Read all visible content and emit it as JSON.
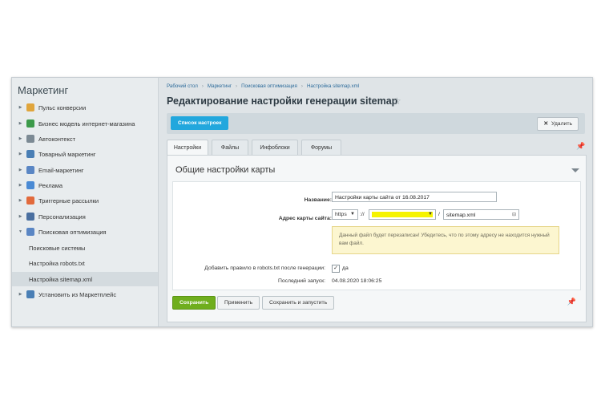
{
  "sidebar": {
    "title": "Маркетинг",
    "items": [
      {
        "label": "Пульс конверсии",
        "icon": "funnel-icon",
        "color": "#e0a53c"
      },
      {
        "label": "Бизнес модель интернет-магазина",
        "icon": "business-model-icon",
        "color": "#3c9a4a"
      },
      {
        "label": "Автоконтекст",
        "icon": "chart-icon",
        "color": "#7c8a94"
      },
      {
        "label": "Товарный маркетинг",
        "icon": "percent-icon",
        "color": "#4a7fb5"
      },
      {
        "label": "Email-маркетинг",
        "icon": "email-icon",
        "color": "#5a86c4"
      },
      {
        "label": "Реклама",
        "icon": "megaphone-icon",
        "color": "#4a8ad4"
      },
      {
        "label": "Триггерные рассылки",
        "icon": "trigger-icon",
        "color": "#e26a3c"
      },
      {
        "label": "Персонализация",
        "icon": "person-icon",
        "color": "#4a6fa0"
      },
      {
        "label": "Поисковая оптимизация",
        "icon": "seo-icon",
        "color": "#5a86c4"
      },
      {
        "label": "Поисковые системы",
        "sub": true
      },
      {
        "label": "Настройка robots.txt",
        "sub": true
      },
      {
        "label": "Настройка sitemap.xml",
        "sub": true,
        "active": true
      },
      {
        "label": "Установить из Маркетплейс",
        "icon": "marketplace-icon",
        "color": "#4a7fb5"
      }
    ]
  },
  "breadcrumbs": [
    "Рабочий стол",
    "Маркетинг",
    "Поисковая оптимизация",
    "Настройка sitemap.xml"
  ],
  "page_title": "Редактирование настройки генерации sitemap",
  "toolbar": {
    "list_button": "Список настроек",
    "delete_button": "Удалить"
  },
  "tabs": [
    "Настройки",
    "Файлы",
    "Инфоблоки",
    "Форумы"
  ],
  "section_title": "Общие настройки карты",
  "form": {
    "name_label": "Название:",
    "name_value": "Настройки карты сайта от 16.08.2017",
    "address_label": "Адрес карты сайта:",
    "protocol_value": "https",
    "protocol_sep": "://",
    "path_sep": "/",
    "file_value": "sitemap.xml",
    "note": "Данный файл будет перезаписан! Убедитесь, что по этому адресу не находится нужный вам файл.",
    "robots_label": "Добавить правило в robots.txt после генерации:",
    "robots_value": "да",
    "robots_checked": true,
    "last_run_label": "Последний запуск:",
    "last_run_value": "04.08.2020 18:06:25"
  },
  "footer": {
    "save": "Сохранить",
    "apply": "Применить",
    "save_run": "Сохранить и запустить"
  },
  "colors": {
    "accent": "#22a7dd",
    "save": "#6fae1d",
    "highlight": "#f5f300"
  }
}
